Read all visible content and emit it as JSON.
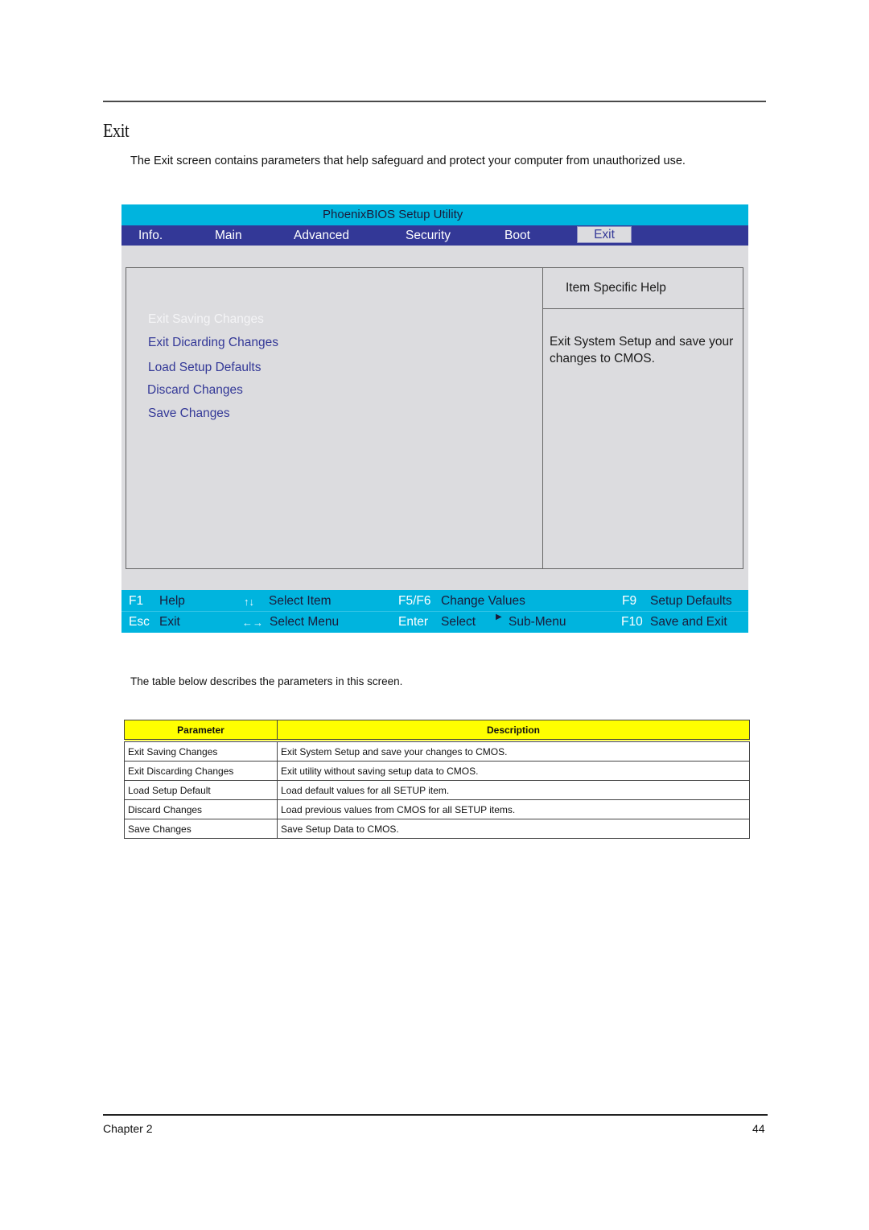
{
  "page": {
    "section_title": "Exit",
    "intro": "The Exit screen contains parameters that help safeguard and protect your computer from unauthorized use.",
    "caption": "The table below describes the parameters in this screen.",
    "footer_left": "Chapter 2",
    "footer_right": "44"
  },
  "bios": {
    "title": "PhoenixBIOS Setup Utility",
    "menu": [
      {
        "label": "Info."
      },
      {
        "label": "Main"
      },
      {
        "label": "Advanced"
      },
      {
        "label": "Security"
      },
      {
        "label": "Boot"
      },
      {
        "label": "Exit",
        "active": true
      }
    ],
    "options": [
      {
        "label": "Exit Saving Changes",
        "selected": true
      },
      {
        "label": "Exit Dicarding Changes"
      },
      {
        "label": "Load Setup Defaults"
      },
      {
        "label": "Discard Changes"
      },
      {
        "label": "Save Changes"
      }
    ],
    "help": {
      "title": "Item Specific Help",
      "text": "Exit System Setup and save your changes to CMOS."
    },
    "keys": {
      "row1": [
        {
          "key": "F1",
          "desc": "Help"
        },
        {
          "key": "↑↓",
          "desc": "Select Item"
        },
        {
          "key": "F5/F6",
          "desc": "Change Values"
        },
        {
          "key": "F9",
          "desc": "Setup Defaults"
        }
      ],
      "row2": [
        {
          "key": "Esc",
          "desc": "Exit"
        },
        {
          "key": "←→",
          "desc": "Select Menu"
        },
        {
          "key": "Enter",
          "desc": "Select",
          "extra": "Sub-Menu"
        },
        {
          "key": "F10",
          "desc": "Save and Exit"
        }
      ]
    },
    "colors": {
      "title_bar": "#00b4de",
      "menu_bar": "#333897",
      "panel": "#dcdcdf",
      "option_text": "#333897"
    }
  },
  "table": {
    "headers": [
      "Parameter",
      "Description"
    ],
    "header_color": "#ffff00",
    "rows": [
      [
        "Exit Saving Changes",
        "Exit System Setup and save your changes to CMOS."
      ],
      [
        "Exit Discarding Changes",
        "Exit utility without saving setup data to CMOS."
      ],
      [
        "Load Setup Default",
        "Load default values for all SETUP item."
      ],
      [
        "Discard Changes",
        "Load previous values from CMOS for all SETUP items."
      ],
      [
        "Save Changes",
        "Save Setup Data to CMOS."
      ]
    ]
  }
}
